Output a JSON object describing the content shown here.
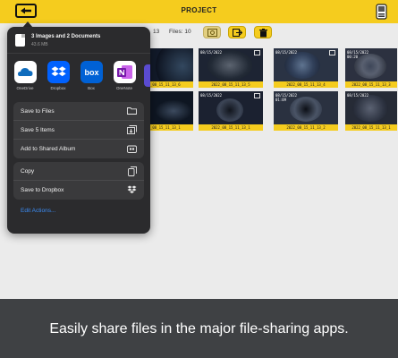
{
  "header": {
    "title": "PROJECT"
  },
  "toolbar": {
    "files_label": "13",
    "files_count": "Files: 10"
  },
  "thumbnails": [
    {
      "stamp": "",
      "stamp2": "",
      "caption": "2022_08_15_11_13_6"
    },
    {
      "stamp": "08/15/2022",
      "stamp2": "",
      "caption": "2022_08_15_11_13_5"
    },
    {
      "stamp": "08/15/2022",
      "stamp2": "",
      "caption": "2022_08_15_11_13_4"
    },
    {
      "stamp": "08/15/2022",
      "stamp2": "00:20",
      "caption": "2022_08_15_11_13_3"
    },
    {
      "stamp": "",
      "stamp2": "",
      "caption": "2022_08_15_11_13_1"
    },
    {
      "stamp": "08/15/2022",
      "stamp2": "",
      "caption": "2022_08_15_11_13_1"
    },
    {
      "stamp": "08/15/2022",
      "stamp2": "01:09",
      "caption": "2022_08_15_11_13_2"
    },
    {
      "stamp": "08/15/2022",
      "stamp2": "",
      "caption": "2022_08_15_11_13_1"
    }
  ],
  "share_sheet": {
    "title": "3 Images and 2 Documents",
    "subtitle": "43.6 MB",
    "apps": [
      {
        "label": "OneDrive",
        "icon": "onedrive-icon",
        "color": "#ffffff"
      },
      {
        "label": "Dropbox",
        "icon": "dropbox-icon",
        "color": "#0061fe"
      },
      {
        "label": "Box",
        "icon": "box-icon",
        "color": "#0061d5"
      },
      {
        "label": "OneNote",
        "icon": "onenote-icon",
        "color": "#ffffff"
      }
    ],
    "actions_group1": [
      {
        "label": "Save to Files",
        "icon": "folder-icon"
      },
      {
        "label": "Save 5 Items",
        "icon": "save-items-icon"
      },
      {
        "label": "Add to Shared Album",
        "icon": "shared-album-icon"
      }
    ],
    "actions_group2": [
      {
        "label": "Copy",
        "icon": "copy-icon"
      },
      {
        "label": "Save to Dropbox",
        "icon": "dropbox-small-icon"
      }
    ],
    "edit_actions": "Edit Actions..."
  },
  "caption": "Easily share files in the major file-sharing apps.",
  "colors": {
    "accent": "#f5cc1e",
    "sheet_bg": "#2b2b2d",
    "link": "#3b8cf5",
    "band": "#3f4144"
  }
}
